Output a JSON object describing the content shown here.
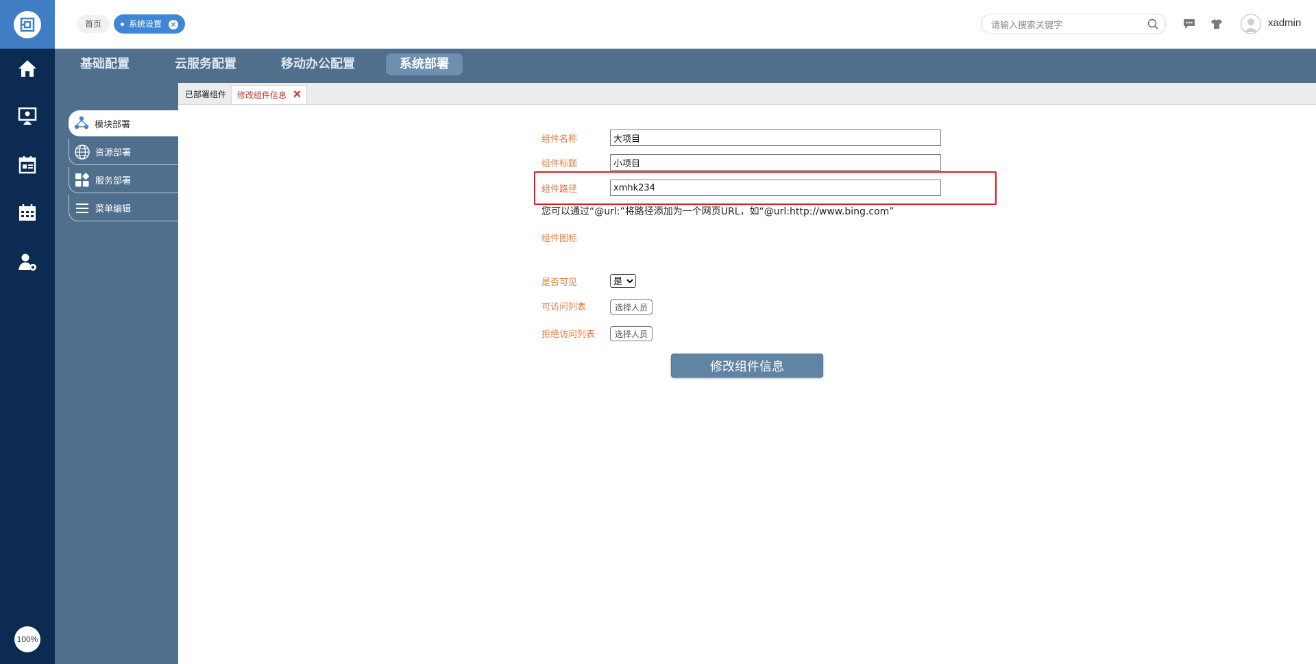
{
  "breadcrumb": {
    "home": "首页",
    "active": "系统设置"
  },
  "search": {
    "placeholder": "请输入搜索关键字"
  },
  "user": {
    "name": "xadmin"
  },
  "rail": {
    "zoom": "100%"
  },
  "nav_tabs": [
    {
      "label": "基础配置",
      "active": false
    },
    {
      "label": "云服务配置",
      "active": false
    },
    {
      "label": "移动办公配置",
      "active": false
    },
    {
      "label": "系统部署",
      "active": true
    }
  ],
  "sidebar": {
    "items": [
      {
        "label": "模块部署",
        "icon": "nodes-icon",
        "active": true
      },
      {
        "label": "资源部署",
        "icon": "globe-icon",
        "active": false
      },
      {
        "label": "服务部署",
        "icon": "blocks-icon",
        "active": false
      },
      {
        "label": "菜单编辑",
        "icon": "menu-lines-icon",
        "active": false
      }
    ]
  },
  "tabs": [
    {
      "label": "已部署组件"
    },
    {
      "label": "修改组件信息",
      "closable": true
    }
  ],
  "form": {
    "name_label": "组件名称",
    "name_value": "大项目",
    "title_label": "组件标题",
    "title_value": "小项目",
    "path_label": "组件路径",
    "path_value": "xmhk234",
    "hint": "您可以通过“@url:”将路径添加为一个网页URL，如“@url:http://www.bing.com”",
    "icon_label": "组件图标",
    "visible_label": "是否可见",
    "visible_value": "是",
    "allow_label": "可访问列表",
    "deny_label": "拒绝访问列表",
    "pick_label": "选择人员",
    "submit_label": "修改组件信息"
  },
  "colors": {
    "rail": "#0b2b52",
    "rail_logo": "#3f7ec2",
    "nav": "#4f6f8d",
    "label": "#e07c3c",
    "highlight": "#e0181b",
    "button": "#5f84a4"
  }
}
